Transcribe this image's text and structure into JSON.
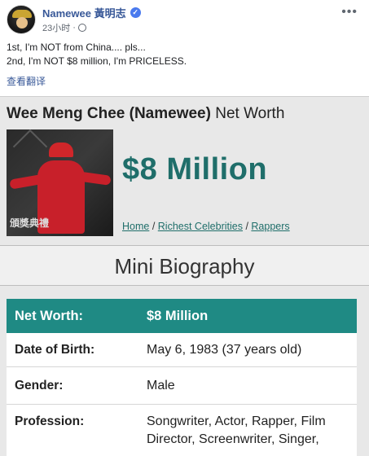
{
  "post": {
    "author": "Namewee 黃明志",
    "time": "23小时",
    "separator": "·",
    "more": "•••",
    "lines": [
      "1st, I'm NOT from China.... pls...",
      "2nd, I'm NOT $8 million, I'm PRICELESS."
    ],
    "translate": "查看翻译"
  },
  "shot": {
    "title_bold": "Wee Meng Chee (Namewee)",
    "title_rest": " Net Worth",
    "photo_caption": "頒獎典禮",
    "net_worth_big": "$8 Million",
    "breadcrumb": {
      "home": "Home",
      "sep1": " / ",
      "richest": "Richest Celebrities",
      "sep2": " / ",
      "rappers": "Rappers"
    },
    "mini_bio": "Mini Biography",
    "rows": [
      {
        "label": "Net Worth:",
        "value": "$8 Million"
      },
      {
        "label": "Date of Birth:",
        "value": "May 6, 1983 (37 years old)"
      },
      {
        "label": "Gender:",
        "value": "Male"
      },
      {
        "label": "Profession:",
        "value": "Songwriter, Actor, Rapper, Film Director, Screenwriter, Singer,"
      }
    ]
  },
  "colors": {
    "teal": "#1f8a84",
    "link_blue": "#385898"
  }
}
